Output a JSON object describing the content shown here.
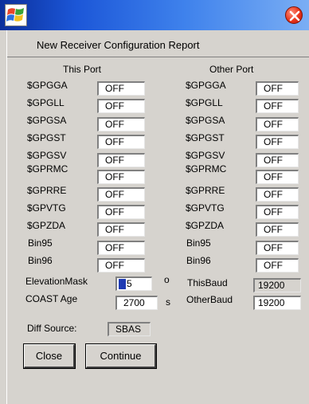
{
  "report_title": "New Receiver  Configuration Report",
  "this_port": {
    "heading": "This Port",
    "rows": [
      {
        "label": "$GPGGA",
        "value": "OFF"
      },
      {
        "label": "$GPGLL",
        "value": "OFF"
      },
      {
        "label": "$GPGSA",
        "value": "OFF"
      },
      {
        "label": "$GPGST",
        "value": "OFF"
      },
      {
        "label": "$GPGSV",
        "value": "OFF"
      },
      {
        "label": "$GPRMC",
        "value": "OFF"
      },
      {
        "label": "$GPRRE",
        "value": "OFF"
      },
      {
        "label": "$GPVTG",
        "value": "OFF"
      },
      {
        "label": "$GPZDA",
        "value": "OFF"
      },
      {
        "label": "Bin95",
        "value": "OFF"
      },
      {
        "label": "Bin96",
        "value": "OFF"
      }
    ]
  },
  "other_port": {
    "heading": "Other Port",
    "rows": [
      {
        "label": "$GPGGA",
        "value": "OFF"
      },
      {
        "label": "$GPGLL",
        "value": "OFF"
      },
      {
        "label": "$GPGSA",
        "value": "OFF"
      },
      {
        "label": "$GPGST",
        "value": "OFF"
      },
      {
        "label": "$GPGSV",
        "value": "OFF"
      },
      {
        "label": "$GPRMC",
        "value": "OFF"
      },
      {
        "label": "$GPRRE",
        "value": "OFF"
      },
      {
        "label": "$GPVTG",
        "value": "OFF"
      },
      {
        "label": "$GPZDA",
        "value": "OFF"
      },
      {
        "label": "Bin95",
        "value": "OFF"
      },
      {
        "label": "Bin96",
        "value": "OFF"
      }
    ]
  },
  "elevation_mask": {
    "label": "ElevationMask",
    "value": "5",
    "unit": "o"
  },
  "coast_age": {
    "label": "COAST Age",
    "value": "2700",
    "unit": "s"
  },
  "this_baud": {
    "label": "ThisBaud",
    "value": "19200"
  },
  "other_baud": {
    "label": "OtherBaud",
    "value": "19200"
  },
  "diff_source": {
    "label": "Diff Source:",
    "value": "SBAS"
  },
  "buttons": {
    "close": "Close",
    "continue": "Continue"
  },
  "icons": {
    "app_logo": "windows-flag-icon",
    "close": "close-icon"
  },
  "colors": {
    "titlebar": "#1c57d8",
    "close": "#e8331a",
    "background": "#d6d3ce"
  }
}
